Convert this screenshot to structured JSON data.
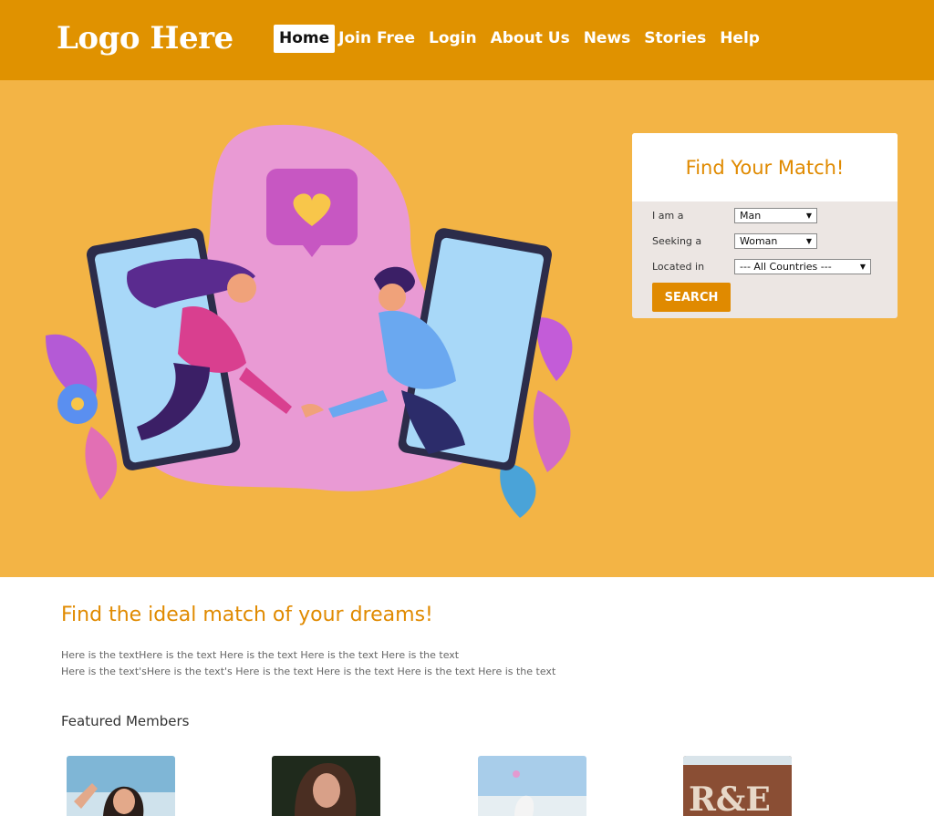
{
  "header": {
    "logo": "Logo Here",
    "nav": [
      {
        "label": "Home"
      },
      {
        "label": "Join Free"
      },
      {
        "label": "Login"
      },
      {
        "label": "About Us"
      },
      {
        "label": "News"
      },
      {
        "label": "Stories"
      },
      {
        "label": "Help"
      }
    ]
  },
  "search": {
    "title": "Find Your Match!",
    "i_am_label": "I am a",
    "i_am_value": "Man",
    "seeking_label": "Seeking a",
    "seeking_value": "Woman",
    "location_label": "Located in",
    "location_value": "--- All Countries ---",
    "button_label": "SEARCH"
  },
  "intro": {
    "title": "Find the ideal match of your dreams!",
    "line1": "Here is the textHere is the text Here is the text Here is the text Here is the text",
    "line2": "Here is the text'sHere is the text's Here is the text Here is the text Here is the text Here is the text"
  },
  "featured": {
    "title": "Featured Members"
  },
  "colors": {
    "header_bg": "#e09200",
    "hero_bg": "#f3b445",
    "accent": "#e08a00"
  }
}
